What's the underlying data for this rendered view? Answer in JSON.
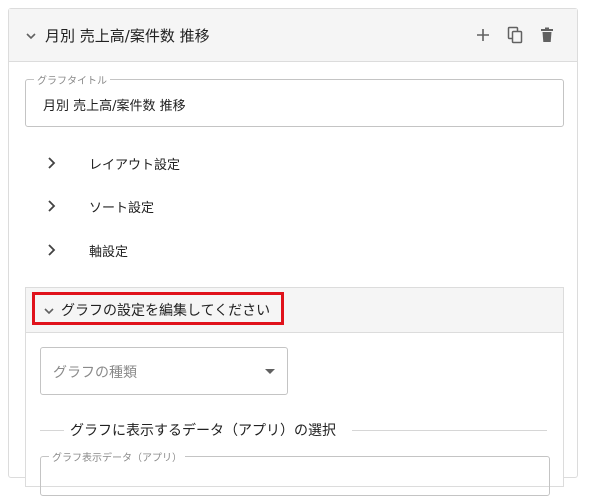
{
  "panel": {
    "title": "月別 売上高/案件数 推移",
    "actions": {
      "add_icon": "plus-icon",
      "copy_icon": "copy-icon",
      "delete_icon": "trash-icon"
    }
  },
  "title_field": {
    "label": "グラフタイトル",
    "value": "月別 売上高/案件数 推移"
  },
  "settings": [
    {
      "label": "レイアウト設定"
    },
    {
      "label": "ソート設定"
    },
    {
      "label": "軸設定"
    }
  ],
  "graph_section": {
    "header_label": "グラフの設定を編集してください",
    "highlight_color": "#e0121b",
    "type_select": {
      "placeholder": "グラフの種類"
    },
    "divider_label": "グラフに表示するデータ（アプリ）の選択",
    "app_field": {
      "label": "グラフ表示データ（アプリ）"
    }
  },
  "colors": {
    "header_bg": "#f5f5f5",
    "border": "#dcdcdc",
    "text": "#212121",
    "muted": "#8a8a8a"
  }
}
